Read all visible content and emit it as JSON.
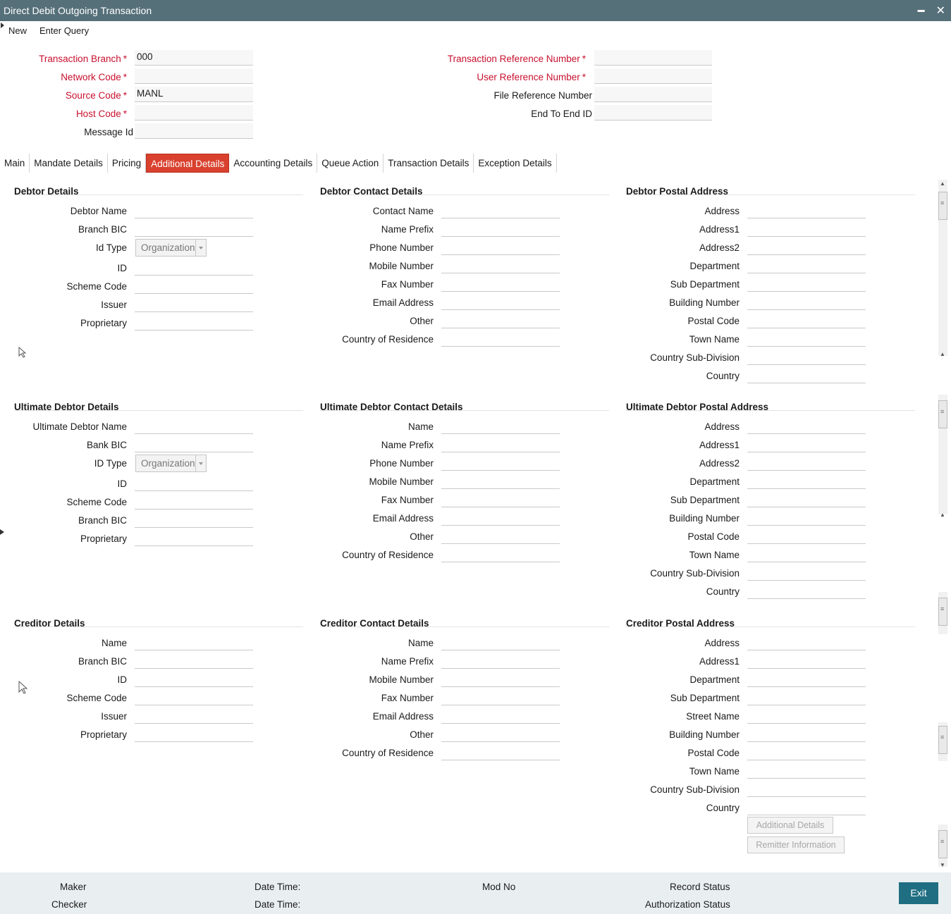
{
  "window": {
    "title": "Direct Debit Outgoing Transaction",
    "minimize": "▬",
    "close": "✕"
  },
  "menu": {
    "new": "New",
    "enter_query": "Enter Query"
  },
  "header": {
    "left": [
      {
        "label": "Transaction Branch",
        "required": true,
        "value": "000"
      },
      {
        "label": "Network Code",
        "required": true,
        "value": ""
      },
      {
        "label": "Source Code",
        "required": true,
        "value": "MANL"
      },
      {
        "label": "Host Code",
        "required": true,
        "value": ""
      },
      {
        "label": "Message Id",
        "required": false,
        "value": ""
      }
    ],
    "right": [
      {
        "label": "Transaction Reference Number",
        "required": true,
        "value": ""
      },
      {
        "label": "User Reference Number",
        "required": true,
        "value": ""
      },
      {
        "label": "File Reference Number",
        "required": false,
        "value": ""
      },
      {
        "label": "End To End ID",
        "required": false,
        "value": ""
      }
    ]
  },
  "tabs": [
    "Main",
    "Mandate Details",
    "Pricing",
    "Additional Details",
    "Accounting Details",
    "Queue Action",
    "Transaction Details",
    "Exception Details"
  ],
  "active_tab": "Additional Details",
  "sections": {
    "debtor": {
      "title": "Debtor Details",
      "fields": [
        "Debtor Name",
        "Branch BIC",
        "Id Type",
        "ID",
        "Scheme Code",
        "Issuer",
        "Proprietary"
      ],
      "id_type_value": "Organization"
    },
    "debtor_contact": {
      "title": "Debtor Contact Details",
      "fields": [
        "Contact Name",
        "Name Prefix",
        "Phone Number",
        "Mobile Number",
        "Fax Number",
        "Email Address",
        "Other",
        "Country of Residence"
      ]
    },
    "debtor_postal": {
      "title": "Debtor Postal Address",
      "fields": [
        "Address",
        "Address1",
        "Address2",
        "Department",
        "Sub Department",
        "Building Number",
        "Postal Code",
        "Town Name",
        "Country Sub-Division",
        "Country"
      ]
    },
    "ult_debtor": {
      "title": "Ultimate Debtor Details",
      "fields": [
        "Ultimate Debtor Name",
        "Bank BIC",
        "ID Type",
        "ID",
        "Scheme Code",
        "Branch BIC",
        "Proprietary"
      ],
      "id_type_value": "Organization"
    },
    "ult_debtor_contact": {
      "title": "Ultimate Debtor Contact Details",
      "fields": [
        "Name",
        "Name Prefix",
        "Phone Number",
        "Mobile Number",
        "Fax Number",
        "Email Address",
        "Other",
        "Country of Residence"
      ]
    },
    "ult_debtor_postal": {
      "title": "Ultimate Debtor Postal Address",
      "fields": [
        "Address",
        "Address1",
        "Address2",
        "Department",
        "Sub Department",
        "Building Number",
        "Postal Code",
        "Town Name",
        "Country Sub-Division",
        "Country"
      ]
    },
    "creditor": {
      "title": "Creditor Details",
      "fields": [
        "Name",
        "Branch BIC",
        "ID",
        "Scheme Code",
        "Issuer",
        "Proprietary"
      ]
    },
    "creditor_contact": {
      "title": "Creditor Contact Details",
      "fields": [
        "Name",
        "Name Prefix",
        "Mobile Number",
        "Fax Number",
        "Email Address",
        "Other",
        "Country of Residence"
      ]
    },
    "creditor_postal": {
      "title": "Creditor Postal Address",
      "fields": [
        "Address",
        "Address1",
        "Department",
        "Sub Department",
        "Street Name",
        "Building Number",
        "Postal Code",
        "Town Name",
        "Country Sub-Division",
        "Country"
      ]
    }
  },
  "buttons": {
    "additional_details": "Additional Details",
    "remitter_information": "Remitter Information"
  },
  "footer": {
    "maker": "Maker",
    "checker": "Checker",
    "date_time_1": "Date Time:",
    "date_time_2": "Date Time:",
    "mod_no": "Mod No",
    "record_status": "Record Status",
    "authorization_status": "Authorization Status",
    "exit": "Exit"
  }
}
